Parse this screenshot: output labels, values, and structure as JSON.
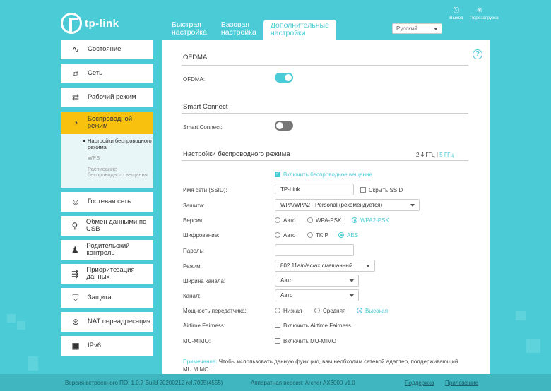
{
  "brand": {
    "logo_text": "tp-link"
  },
  "tabs": [
    {
      "label": "Быстрая\nнастройка"
    },
    {
      "label": "Базовая\nнастройка"
    },
    {
      "label": "Дополнительные\nнастройки"
    }
  ],
  "language": {
    "selected": "Русский"
  },
  "top_actions": {
    "logout": "Выход",
    "reboot": "Перезагрузка"
  },
  "sidebar": {
    "items": [
      {
        "label": "Состояние",
        "icon": "pulse-icon"
      },
      {
        "label": "Сеть",
        "icon": "network-icon"
      },
      {
        "label": "Рабочий режим",
        "icon": "mode-icon"
      },
      {
        "label": "Беспроводной режим",
        "icon": "wifi-icon"
      },
      {
        "label": "Гостевая сеть",
        "icon": "guest-icon"
      },
      {
        "label": "Обмен данными по USB",
        "icon": "usb-icon"
      },
      {
        "label": "Родительский контроль",
        "icon": "parental-icon"
      },
      {
        "label": "Приоритезация данных",
        "icon": "qos-icon"
      },
      {
        "label": "Защита",
        "icon": "shield-icon"
      },
      {
        "label": "NAT переадресация",
        "icon": "nat-icon"
      },
      {
        "label": "IPv6",
        "icon": "ipv6-icon"
      }
    ],
    "submenu": [
      "Настройки беспроводного режима",
      "WPS",
      "Расписание беспроводного вещания"
    ]
  },
  "ofdma": {
    "title": "OFDMA",
    "label": "OFDMA:",
    "enabled": true
  },
  "smart_connect": {
    "title": "Smart Connect",
    "label": "Smart Connect:",
    "enabled": false
  },
  "wireless": {
    "title": "Настройки беспроводного режима",
    "band_24": "2,4 ГГц",
    "band_sep": "|",
    "band_5": "5 ГГц",
    "enable_broadcast": "Включить беспроводное вещание",
    "ssid_label": "Имя сети (SSID):",
    "ssid_value": "TP-Link",
    "hide_ssid": "Скрыть SSID",
    "security_label": "Защита:",
    "security_value": "WPA/WPA2 - Personal (рекомендуется)",
    "version_label": "Версия:",
    "version_options": [
      "Авто",
      "WPA-PSK",
      "WPA2-PSK"
    ],
    "version_selected": "WPA2-PSK",
    "encryption_label": "Шифрование:",
    "encryption_options": [
      "Авто",
      "TKIP",
      "AES"
    ],
    "encryption_selected": "AES",
    "password_label": "Пароль:",
    "password_value": "",
    "mode_label": "Режим:",
    "mode_value": "802.11a/n/ac/ax смешанный",
    "width_label": "Ширина канала:",
    "width_value": "Авто",
    "channel_label": "Канал:",
    "channel_value": "Авто",
    "power_label": "Мощность передатчика:",
    "power_options": [
      "Низкая",
      "Средняя",
      "Высокая"
    ],
    "power_selected": "Высокая",
    "airtime_label": "Airtime Fairness:",
    "airtime_option": "Включить Airtime Fairness",
    "mumimo_label": "MU-MIMO:",
    "mumimo_option": "Включить MU-MIMO",
    "note_key": "Примечание:",
    "note_text": "Чтобы использовать данную функцию, вам необходим сетевой адаптер, поддерживающий MU MIMO."
  },
  "footer": {
    "firmware": "Версия встроенного ПО: 1.0.7 Build 20200212 rel.7095(4555)",
    "hardware": "Аппаратная версия: Archer AX6000 v1.0",
    "support": "Поддержка",
    "app": "Приложение"
  },
  "colors": {
    "accent": "#4acbd6",
    "active_menu": "#f8c10d"
  }
}
